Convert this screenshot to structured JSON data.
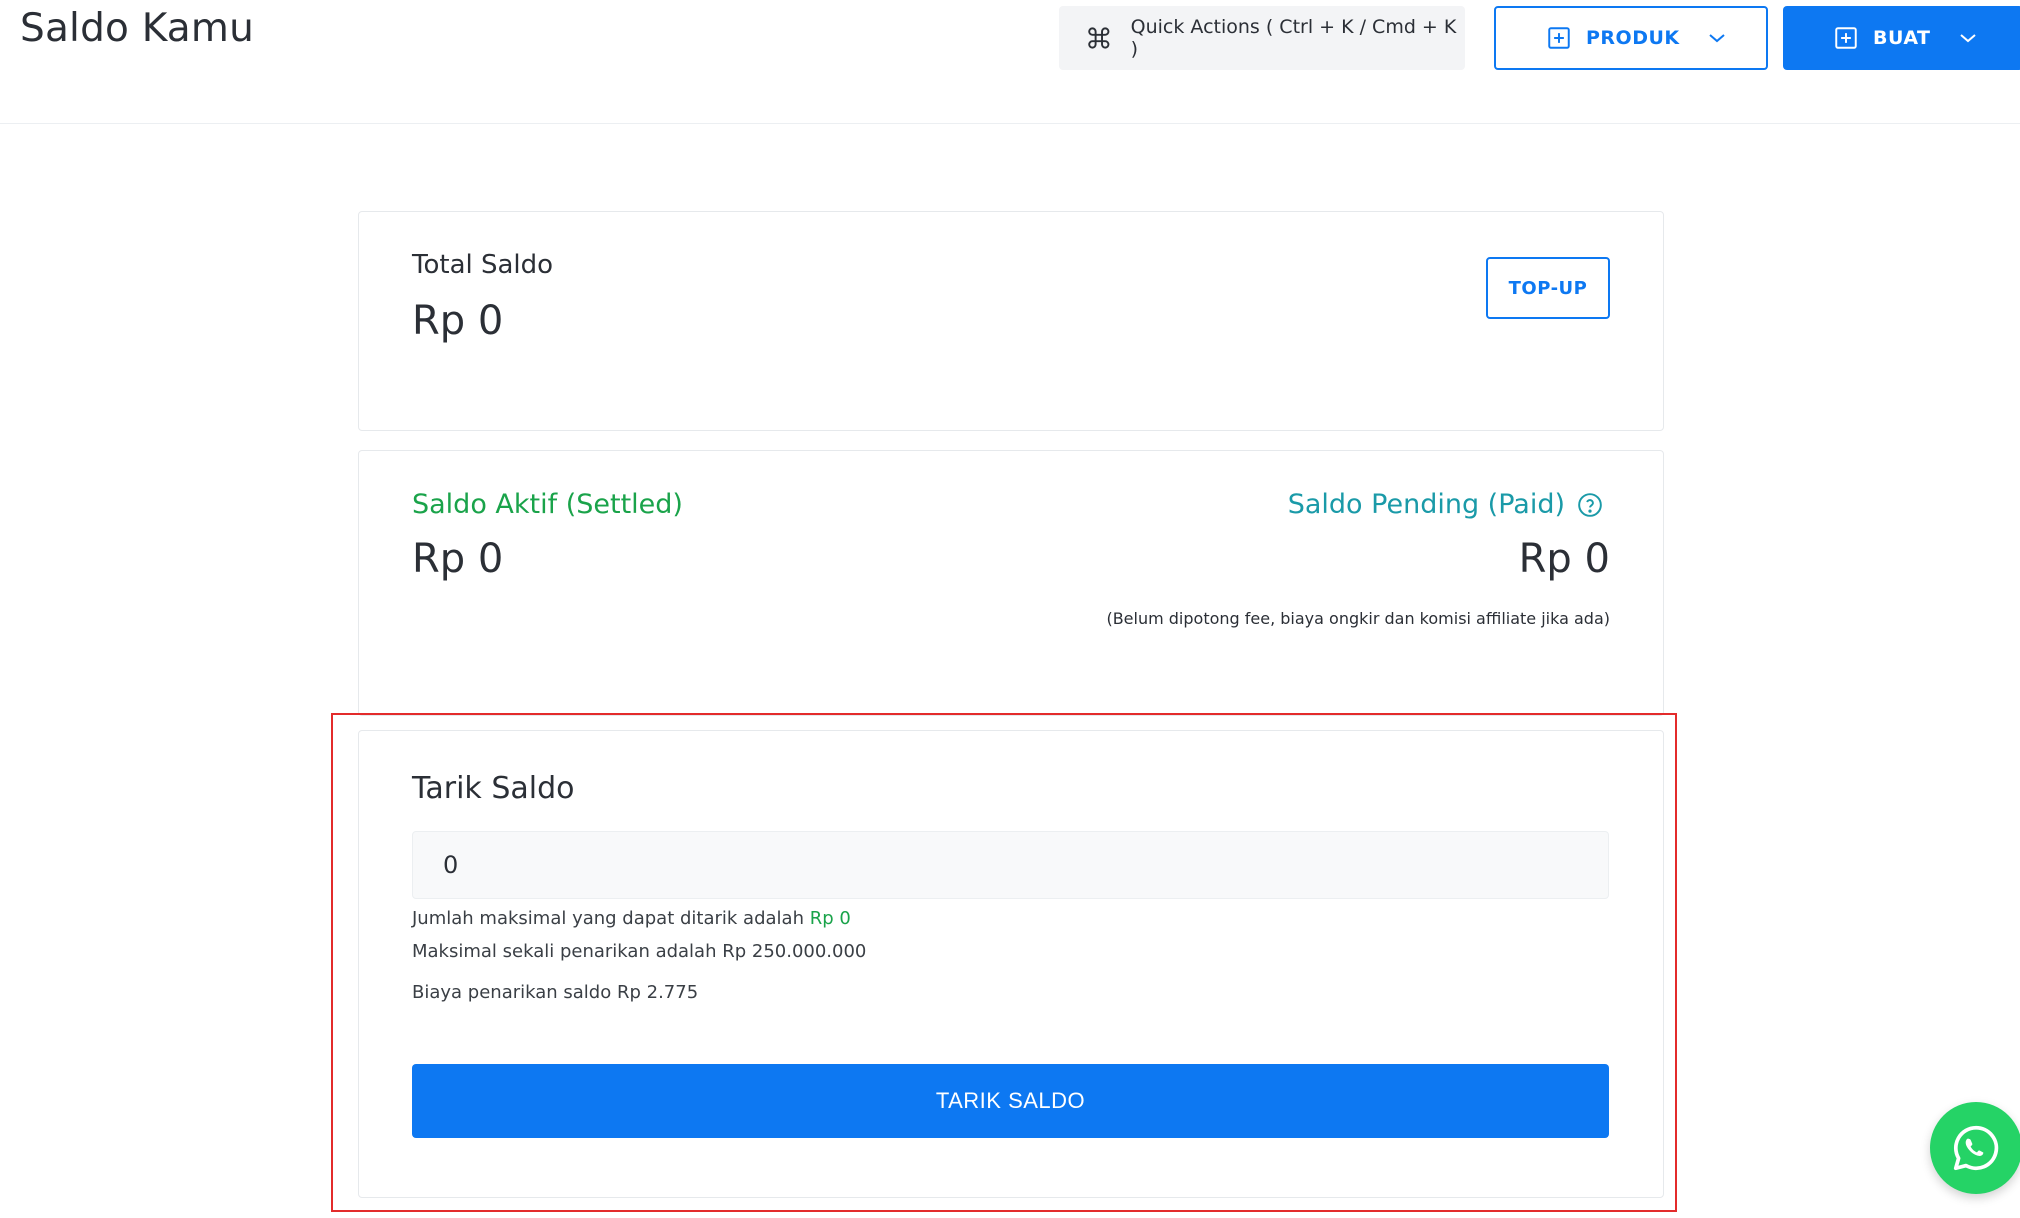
{
  "header": {
    "title": "Saldo Kamu",
    "quick_actions_label": "Quick Actions ( Ctrl + K / Cmd + K )",
    "produk_label": "PRODUK",
    "buat_label": "BUAT"
  },
  "total_card": {
    "label": "Total Saldo",
    "amount": "Rp 0",
    "topup_label": "TOP-UP"
  },
  "balance_card": {
    "active_label": "Saldo Aktif (Settled)",
    "active_amount": "Rp 0",
    "pending_label": "Saldo Pending (Paid)",
    "pending_amount": "Rp 0",
    "pending_note": "(Belum dipotong fee, biaya ongkir dan komisi affiliate jika ada)"
  },
  "withdraw_card": {
    "title": "Tarik Saldo",
    "input_value": "0",
    "max_text_prefix": "Jumlah maksimal yang dapat ditarik adalah",
    "max_amount": "Rp 0",
    "max_once_text": "Maksimal sekali penarikan adalah Rp 250.000.000",
    "fee_text": "Biaya penarikan saldo Rp 2.775",
    "button_label": "TARIK SALDO"
  },
  "colors": {
    "primary": "#0d78f2",
    "active_green": "#1aa34a",
    "pending_teal": "#1a9aa8",
    "highlight_red": "#e32b2b",
    "whatsapp_green": "#25d366"
  }
}
